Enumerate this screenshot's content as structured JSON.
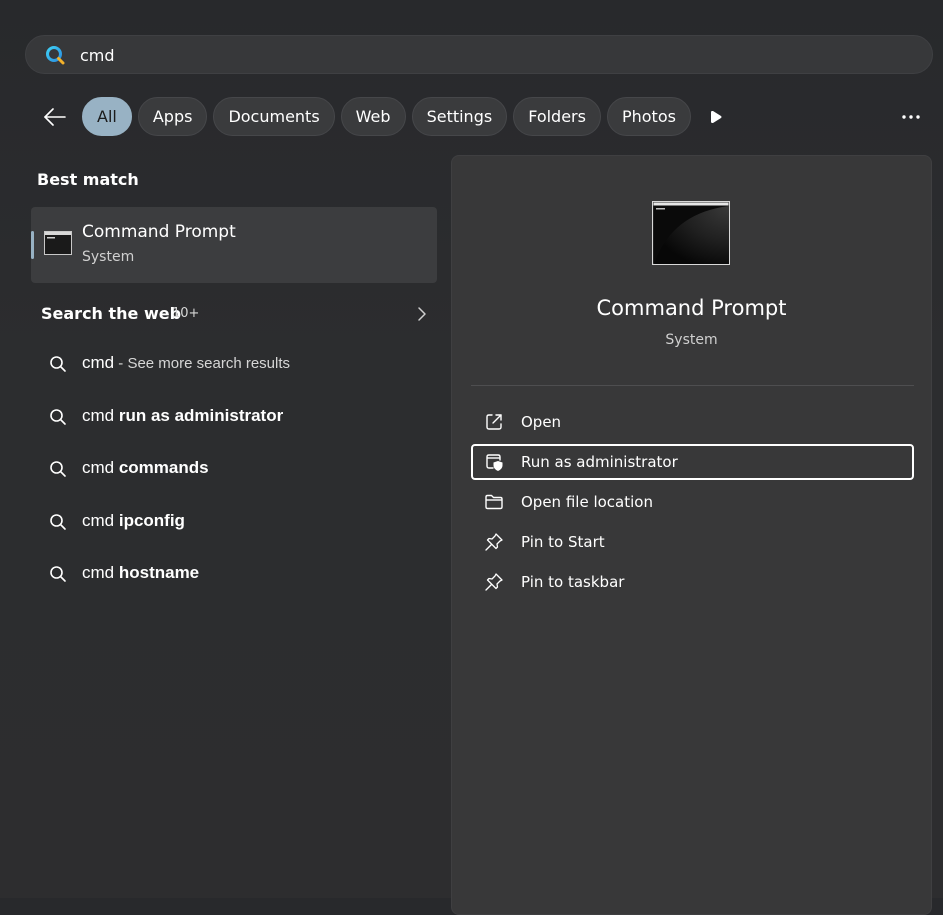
{
  "search": {
    "value": "cmd",
    "placeholder": ""
  },
  "filters": [
    {
      "label": "All",
      "active": true
    },
    {
      "label": "Apps",
      "active": false
    },
    {
      "label": "Documents",
      "active": false
    },
    {
      "label": "Web",
      "active": false
    },
    {
      "label": "Settings",
      "active": false
    },
    {
      "label": "Folders",
      "active": false
    },
    {
      "label": "Photos",
      "active": false
    }
  ],
  "best_match": {
    "heading": "Best match",
    "title": "Command Prompt",
    "subtitle": "System"
  },
  "web": {
    "heading": "Search the web",
    "count": "10+",
    "results": [
      {
        "prefix": "cmd",
        "bold": "",
        "hint": " - See more search results"
      },
      {
        "prefix": "cmd ",
        "bold": "run as administrator",
        "hint": ""
      },
      {
        "prefix": "cmd ",
        "bold": "commands",
        "hint": ""
      },
      {
        "prefix": "cmd ",
        "bold": "ipconfig",
        "hint": ""
      },
      {
        "prefix": "cmd ",
        "bold": "hostname",
        "hint": ""
      }
    ]
  },
  "detail": {
    "title": "Command Prompt",
    "subtitle": "System",
    "actions": [
      {
        "label": "Open",
        "icon": "open-external-icon",
        "focused": false
      },
      {
        "label": "Run as administrator",
        "icon": "shield-window-icon",
        "focused": true
      },
      {
        "label": "Open file location",
        "icon": "folder-icon",
        "focused": false
      },
      {
        "label": "Pin to Start",
        "icon": "pin-icon",
        "focused": false
      },
      {
        "label": "Pin to taskbar",
        "icon": "pin-icon",
        "focused": false
      }
    ]
  },
  "colors": {
    "accent": "#98b2c4",
    "background": "#2b2c2e",
    "pane": "#383839"
  }
}
